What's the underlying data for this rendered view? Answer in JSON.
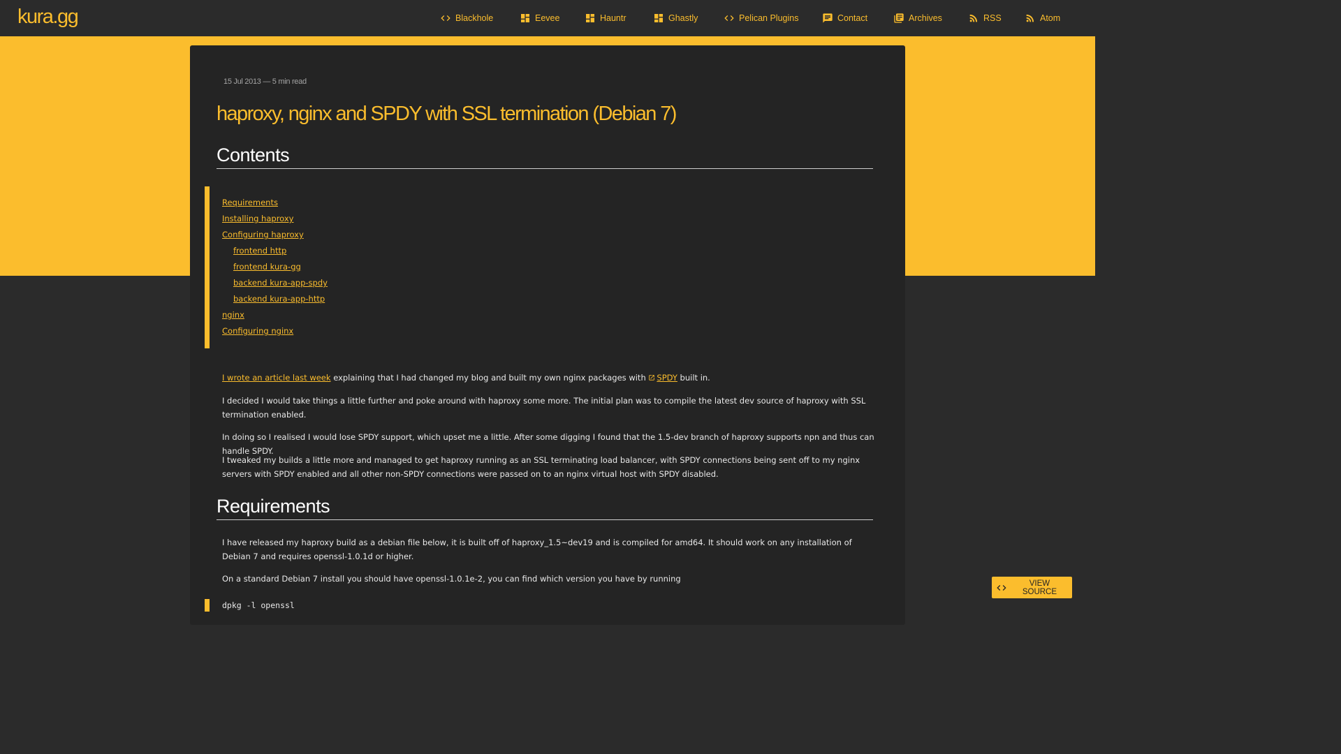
{
  "site": {
    "logo": "kura.gg"
  },
  "nav": [
    {
      "label": "Blackhole",
      "icon": "code-icon"
    },
    {
      "label": "Eevee",
      "icon": "dashboard-icon"
    },
    {
      "label": "Hauntr",
      "icon": "dashboard-icon"
    },
    {
      "label": "Ghastly",
      "icon": "dashboard-icon"
    },
    {
      "label": "Pelican Plugins",
      "icon": "code-icon"
    },
    {
      "label": "Contact",
      "icon": "message-icon"
    },
    {
      "label": "Archives",
      "icon": "library-icon"
    },
    {
      "label": "RSS",
      "icon": "rss-icon"
    },
    {
      "label": "Atom",
      "icon": "rss-icon"
    }
  ],
  "article": {
    "meta": "15 Jul 2013 — 5 min read",
    "title": "haproxy, nginx and SPDY with SSL termination (Debian 7)",
    "contents_heading": "Contents",
    "toc": [
      {
        "label": "Requirements",
        "level": 1
      },
      {
        "label": "Installing haproxy",
        "level": 1
      },
      {
        "label": "Configuring haproxy",
        "level": 1
      },
      {
        "label": "frontend http",
        "level": 2
      },
      {
        "label": "frontend kura-gg",
        "level": 2
      },
      {
        "label": "backend kura-app-spdy",
        "level": 2
      },
      {
        "label": "backend kura-app-http",
        "level": 2
      },
      {
        "label": "nginx",
        "level": 1
      },
      {
        "label": "Configuring nginx",
        "level": 1
      }
    ],
    "intro": {
      "link1": "I wrote an article last week",
      "text1": " explaining that I had changed my blog and built my own nginx packages with ",
      "link2": "SPDY",
      "text2": " built in."
    },
    "paragraphs": [
      "I decided I would take things a little further and poke around with haproxy some more. The initial plan was to compile the latest dev source of haproxy with SSL termination enabled.",
      "In doing so I realised I would lose SPDY support, which upset me a little. After some digging I found that the 1.5-dev branch of haproxy supports npn and thus can handle SPDY.",
      "I tweaked my builds a little more and managed to get haproxy running as an SSL terminating load balancer, with SPDY connections being sent off to my nginx servers with SPDY enabled and all other non-SPDY connections were passed on to an nginx virtual host with SPDY disabled."
    ],
    "requirements_heading": "Requirements",
    "req_paragraphs": [
      "I have released my haproxy build as a debian file below, it is built off of haproxy_1.5~dev19 and is compiled for amd64. It should work on any installation of Debian 7 and requires openssl-1.0.1d or higher.",
      "On a standard Debian 7 install you should have openssl-1.0.1e-2, you can find which version you have by running"
    ],
    "code": "dpkg -l openssl"
  },
  "view_source": {
    "label": "VIEW SOURCE",
    "icon": "code-icon"
  },
  "colors": {
    "accent": "#fbbd2d",
    "background": "#2b2b2b",
    "card": "#242424"
  }
}
